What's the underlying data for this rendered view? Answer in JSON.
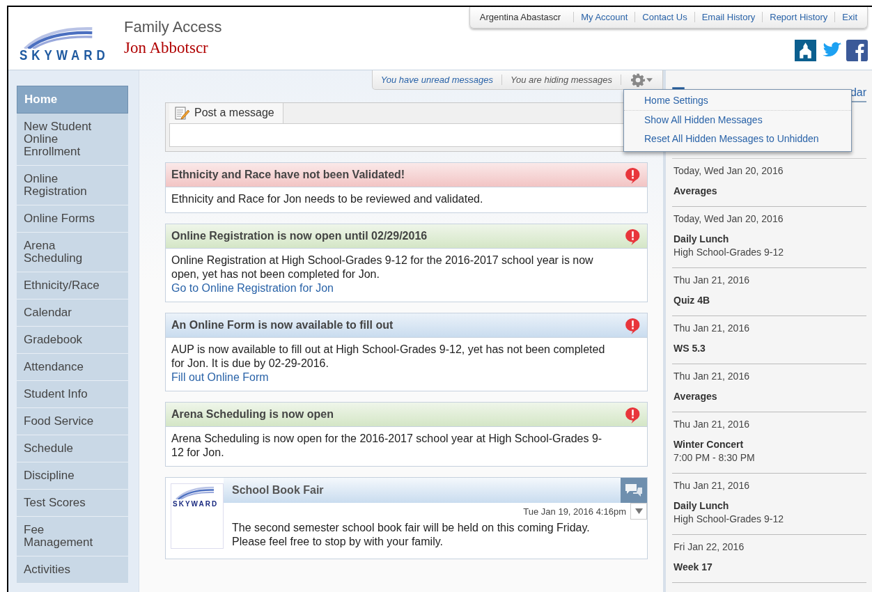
{
  "header": {
    "logo_text": "SKYWARD",
    "app_title": "Family Access",
    "student_name": "Jon Abbotscr",
    "top_links": [
      {
        "label": "Argentina Abastascr",
        "kind": "user"
      },
      {
        "label": "My Account",
        "kind": "link"
      },
      {
        "label": "Contact Us",
        "kind": "link"
      },
      {
        "label": "Email History",
        "kind": "link"
      },
      {
        "label": "Report History",
        "kind": "link"
      },
      {
        "label": "Exit",
        "kind": "link"
      }
    ]
  },
  "sidebar": {
    "items": [
      {
        "label": "Home",
        "selected": true
      },
      {
        "label": "New Student Online Enrollment",
        "selected": false
      },
      {
        "label": "Online Registration",
        "selected": false
      },
      {
        "label": "Online Forms",
        "selected": false
      },
      {
        "label": "Arena Scheduling",
        "selected": false
      },
      {
        "label": "Ethnicity/Race",
        "selected": false
      },
      {
        "label": "Calendar",
        "selected": false
      },
      {
        "label": "Gradebook",
        "selected": false
      },
      {
        "label": "Attendance",
        "selected": false
      },
      {
        "label": "Student Info",
        "selected": false
      },
      {
        "label": "Food Service",
        "selected": false
      },
      {
        "label": "Schedule",
        "selected": false
      },
      {
        "label": "Discipline",
        "selected": false
      },
      {
        "label": "Test Scores",
        "selected": false
      },
      {
        "label": "Fee Management",
        "selected": false
      },
      {
        "label": "Activities",
        "selected": false
      }
    ]
  },
  "message_bar": {
    "unread": "You have unread messages",
    "hiding": "You are hiding messages"
  },
  "settings_menu": {
    "items": [
      "Home Settings",
      "Show All Hidden Messages",
      "Reset All Hidden Messages to Unhidden"
    ]
  },
  "post_box": {
    "tab": "Post a message"
  },
  "messages": [
    {
      "kind": "alert",
      "color": "#f2c4c4",
      "title": "Ethnicity and Race have not been Validated!",
      "body": "Ethnicity and Race for Jon needs to be reviewed and validated."
    },
    {
      "kind": "alert",
      "color": "#d4e6c6",
      "title": "Online Registration is now open until 02/29/2016",
      "body": "Online Registration at High School-Grades 9-12 for the 2016-2017 school year is now open, yet has not been completed for Jon.",
      "link": "Go to Online Registration for Jon"
    },
    {
      "kind": "alert",
      "color": "#c9dcef",
      "title": "An Online Form is now available to fill out",
      "body": "AUP is now available to fill out at High School-Grades 9-12, yet has not been completed for Jon.  It is due by 02-29-2016.",
      "link": "Fill out Online Form"
    },
    {
      "kind": "alert",
      "color": "#d4e6c6",
      "title": "Arena Scheduling is now open",
      "body": "Arena Scheduling is now open for the 2016-2017 school year at High School-Grades 9-12 for Jon."
    },
    {
      "kind": "post",
      "color": "#c9dcef",
      "logo_text": "SKYWARD",
      "title": "School Book Fair",
      "time": "Tue Jan 19, 2016 4:16pm",
      "body": "The second semester school book fair will be held on this coming Friday. Please feel free to stop by with your family."
    }
  ],
  "events_panel": {
    "calendar_link": "dar",
    "events": [
      {
        "date": "Today, Wed Jan 20, 2016",
        "title": "Averages"
      },
      {
        "date": "Today, Wed Jan 20, 2016",
        "title": "Daily Lunch",
        "detail": "High School-Grades 9-12"
      },
      {
        "date": "Thu Jan 21, 2016",
        "title": "Quiz 4B"
      },
      {
        "date": "Thu Jan 21, 2016",
        "title": "WS 5.3"
      },
      {
        "date": "Thu Jan 21, 2016",
        "title": "Averages"
      },
      {
        "date": "Thu Jan 21, 2016",
        "title": "Winter Concert",
        "detail": "7:00 PM - 8:30 PM"
      },
      {
        "date": "Thu Jan 21, 2016",
        "title": "Daily Lunch",
        "detail": "High School-Grades 9-12"
      },
      {
        "date": "Fri Jan 22, 2016",
        "title": "Week 17"
      }
    ]
  }
}
